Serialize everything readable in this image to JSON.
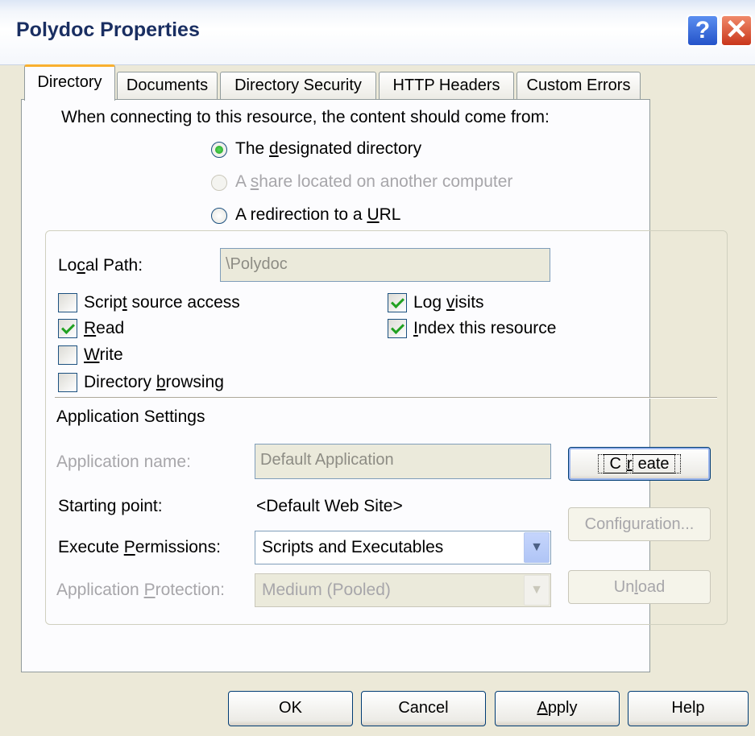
{
  "window": {
    "title": "Polydoc Properties",
    "help_glyph": "?",
    "close_glyph": "✕"
  },
  "tabs": [
    {
      "label": "Directory",
      "active": true
    },
    {
      "label": "Documents"
    },
    {
      "label": "Directory Security"
    },
    {
      "label": "HTTP Headers"
    },
    {
      "label": "Custom Errors"
    }
  ],
  "content_source": {
    "prompt": "When connecting to this resource, the content should come from:",
    "options": [
      {
        "pre": "The ",
        "key": "d",
        "post": "esignated directory",
        "selected": true,
        "enabled": true
      },
      {
        "pre": "A ",
        "key": "s",
        "post": "hare located on another computer",
        "selected": false,
        "enabled": false
      },
      {
        "pre": "A redirection to a ",
        "key": "U",
        "post": "RL",
        "selected": false,
        "enabled": true
      }
    ]
  },
  "local_path": {
    "label_pre": "Lo",
    "label_key": "c",
    "label_post": "al Path:",
    "value": "\\Polydoc"
  },
  "checkboxes": {
    "script_source": {
      "pre": "Scrip",
      "key": "t",
      "post": " source access",
      "checked": false
    },
    "read": {
      "pre": "",
      "key": "R",
      "post": "ead",
      "checked": true
    },
    "write": {
      "pre": "",
      "key": "W",
      "post": "rite",
      "checked": false
    },
    "dir_browsing": {
      "pre": "Directory ",
      "key": "b",
      "post": "rowsing",
      "checked": false
    },
    "log_visits": {
      "pre": "Log ",
      "key": "v",
      "post": "isits",
      "checked": true
    },
    "index": {
      "pre": "",
      "key": "I",
      "post": "ndex this resource",
      "checked": true
    }
  },
  "app_settings": {
    "heading": "Application Settings",
    "app_name_label": "Application name:",
    "app_name_value": "Default Application",
    "starting_point_label": "Starting point:",
    "starting_point_value": "<Default Web Site>",
    "exec_perm_pre": "Execute ",
    "exec_perm_key": "P",
    "exec_perm_post": "ermissions:",
    "exec_perm_value": "Scripts and Executables",
    "protection_pre": "Application ",
    "protection_key": "P",
    "protection_post": "rotection:",
    "protection_value": "Medium (Pooled)",
    "create_pre": "C",
    "create_key": "r",
    "create_post": "eate",
    "configuration_label": "Configuration...",
    "unload_pre": "Un",
    "unload_key": "l",
    "unload_post": "oad",
    "dropdown_glyph": "▼"
  },
  "footer": {
    "ok": "OK",
    "cancel": "Cancel",
    "apply_key": "A",
    "apply_post": "pply",
    "help": "Help"
  }
}
